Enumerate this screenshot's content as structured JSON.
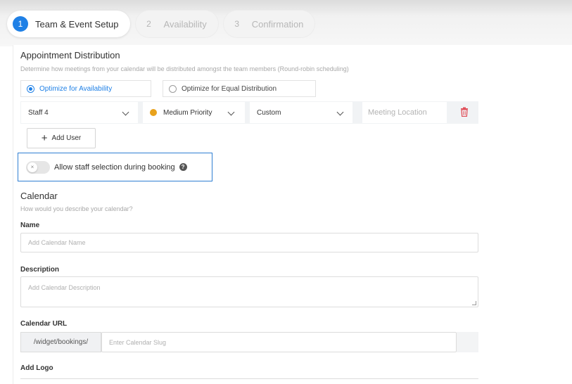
{
  "stepper": [
    {
      "num": "1",
      "label": "Team & Event Setup",
      "active": true
    },
    {
      "num": "2",
      "label": "Availability",
      "active": false
    },
    {
      "num": "3",
      "label": "Confirmation",
      "active": false
    }
  ],
  "distribution": {
    "title": "Appointment Distribution",
    "subtitle": "Determine how meetings from your calendar will be distributed amongst the team members (Round-robin scheduling)",
    "options": [
      {
        "label": "Optimize for Availability",
        "selected": true
      },
      {
        "label": "Optimize for Equal Distribution",
        "selected": false
      }
    ]
  },
  "user_row": {
    "staff": "Staff 4",
    "priority": "Medium Priority",
    "priority_color": "#e8a21c",
    "location_type": "Custom",
    "location_placeholder": "Meeting Location"
  },
  "add_user_label": "Add User",
  "staff_selection_label": "Allow staff selection during booking",
  "calendar": {
    "title": "Calendar",
    "subtitle": "How would you describe your calendar?",
    "name_label": "Name",
    "name_placeholder": "Add Calendar Name",
    "description_label": "Description",
    "description_placeholder": "Add Calendar Description",
    "url_label": "Calendar URL",
    "url_prefix": "/widget/bookings/",
    "url_placeholder": "Enter Calendar Slug",
    "logo_label": "Add Logo"
  },
  "accent_color": "#1f80e6"
}
